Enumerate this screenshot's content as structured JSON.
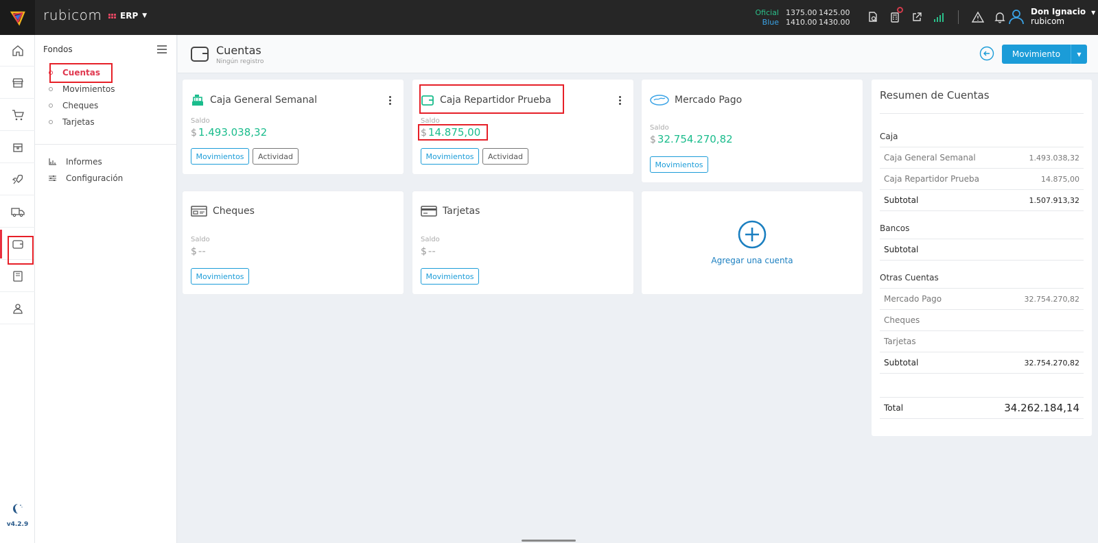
{
  "topbar": {
    "brand": "rubicom",
    "module": "ERP",
    "rates": [
      {
        "label": "Oficial",
        "buy": "1375.00",
        "sell": "1425.00"
      },
      {
        "label": "Blue",
        "buy": "1410.00",
        "sell": "1430.00"
      }
    ],
    "user": {
      "name": "Don Ignacio",
      "company": "rubicom"
    }
  },
  "rail": {
    "version": "v4.2.9"
  },
  "sidebar": {
    "title": "Fondos",
    "items": [
      "Cuentas",
      "Movimientos",
      "Cheques",
      "Tarjetas"
    ],
    "extra": [
      "Informes",
      "Configuración"
    ]
  },
  "page": {
    "title": "Cuentas",
    "subtitle": "Ningún registro",
    "primary_button": "Movimiento"
  },
  "cards": [
    {
      "title": "Caja General Semanal",
      "saldo_label": "Saldo",
      "currency": "$",
      "value": "1.493.038,32",
      "btn1": "Movimientos",
      "btn2": "Actividad"
    },
    {
      "title": "Caja Repartidor Prueba",
      "saldo_label": "Saldo",
      "currency": "$",
      "value": "14.875,00",
      "btn1": "Movimientos",
      "btn2": "Actividad"
    },
    {
      "title": "Mercado Pago",
      "saldo_label": "Saldo",
      "currency": "$",
      "value": "32.754.270,82",
      "btn1": "Movimientos"
    },
    {
      "title": "Cheques",
      "saldo_label": "Saldo",
      "currency": "$",
      "value": "--",
      "btn1": "Movimientos"
    },
    {
      "title": "Tarjetas",
      "saldo_label": "Saldo",
      "currency": "$",
      "value": "--",
      "btn1": "Movimientos"
    }
  ],
  "add_account": "Agregar una cuenta",
  "summary": {
    "title": "Resumen de Cuentas",
    "caja": {
      "label": "Caja",
      "rows": [
        {
          "k": "Caja General Semanal",
          "v": "1.493.038,32"
        },
        {
          "k": "Caja Repartidor Prueba",
          "v": "14.875,00"
        }
      ],
      "subtotal_label": "Subtotal",
      "subtotal": "1.507.913,32"
    },
    "bancos": {
      "label": "Bancos",
      "subtotal_label": "Subtotal"
    },
    "otras": {
      "label": "Otras Cuentas",
      "rows": [
        {
          "k": "Mercado Pago",
          "v": "32.754.270,82"
        },
        {
          "k": "Cheques",
          "v": ""
        },
        {
          "k": "Tarjetas",
          "v": ""
        }
      ],
      "subtotal_label": "Subtotal",
      "subtotal": "32.754.270,82"
    },
    "total_label": "Total",
    "total": "34.262.184,14"
  },
  "colors": {
    "accent": "#1b9cd8",
    "positive": "#1abc8c",
    "active_nav": "#e0384f",
    "highlight": "#e61f27"
  }
}
